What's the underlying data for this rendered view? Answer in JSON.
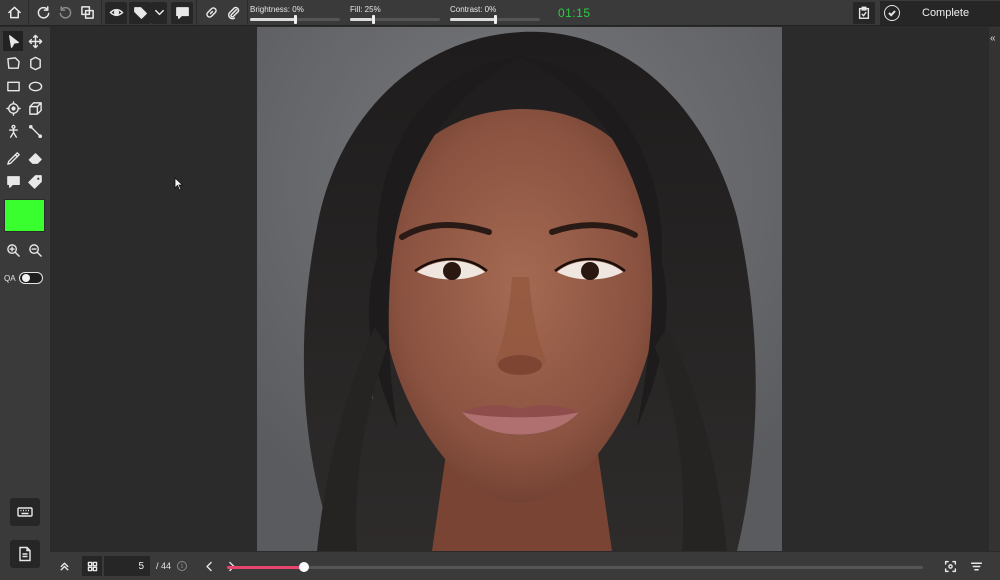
{
  "toolbar": {
    "icons": [
      "home-icon",
      "redo-circle-icon",
      "undo-circle-icon",
      "copy-icon",
      "eye-icon",
      "tag-icon",
      "chevron-down-icon",
      "comment-icon",
      "link-icon",
      "paperclip-icon"
    ],
    "brightness_label": "Brightness: 0%",
    "brightness_value": 0,
    "fill_label": "Fill: 25%",
    "fill_value": 25,
    "contrast_label": "Contrast: 0%",
    "contrast_value": 0,
    "timer": "01:15",
    "timer_color": "#2ecc40",
    "complete_label": "Complete"
  },
  "tools": [
    "select-arrow-icon",
    "move-icon",
    "bbox-icon",
    "polygon-icon",
    "rectangle-icon",
    "ellipse-icon",
    "keypoint-icon",
    "cuboid-icon",
    "skeleton-icon",
    "line-icon",
    "eyedropper-icon",
    "eraser-icon",
    "comment-tool-icon",
    "tag-tool-icon",
    "zoom-in-icon",
    "zoom-out-icon"
  ],
  "color": {
    "active": "#39ff2e"
  },
  "qa": {
    "label": "QA",
    "enabled": false
  },
  "pagination": {
    "current_page": "5",
    "total": "/ 44",
    "progress": 0.11,
    "progress_color": "#e8456e"
  }
}
